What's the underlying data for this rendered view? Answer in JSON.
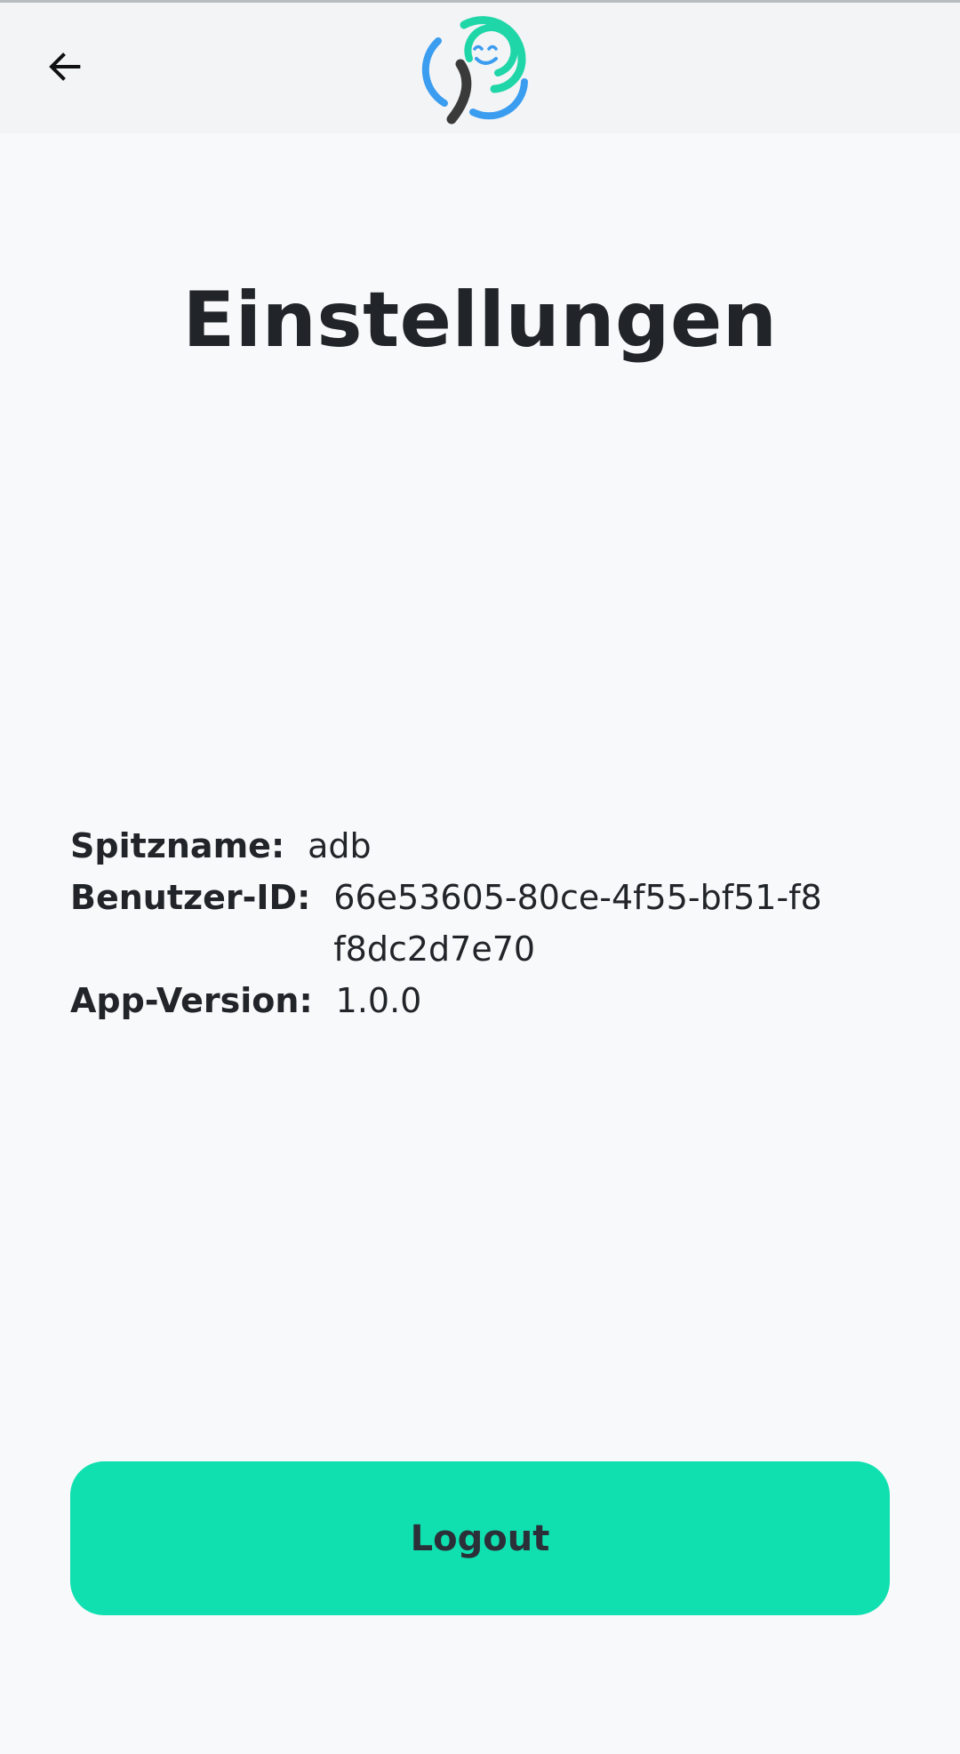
{
  "header": {
    "back_icon": "arrow-left-icon",
    "logo_icon": "app-logo-smiley-icon"
  },
  "page": {
    "title": "Einstellungen"
  },
  "info": {
    "nickname_label": "Spitzname:",
    "nickname_value": "adb",
    "user_id_label": "Benutzer-ID:",
    "user_id_value": "66e53605-80ce-4f55-bf51-f8f8dc2d7e70",
    "app_version_label": "App-Version:",
    "app_version_value": "1.0.0"
  },
  "actions": {
    "logout_label": "Logout"
  },
  "colors": {
    "accent": "#10e0b0",
    "logo_green": "#1fd6a8",
    "logo_blue": "#3b9df0",
    "logo_dark": "#3a3a3a",
    "background": "#f8f9fa",
    "app_bar": "#f3f4f6"
  }
}
